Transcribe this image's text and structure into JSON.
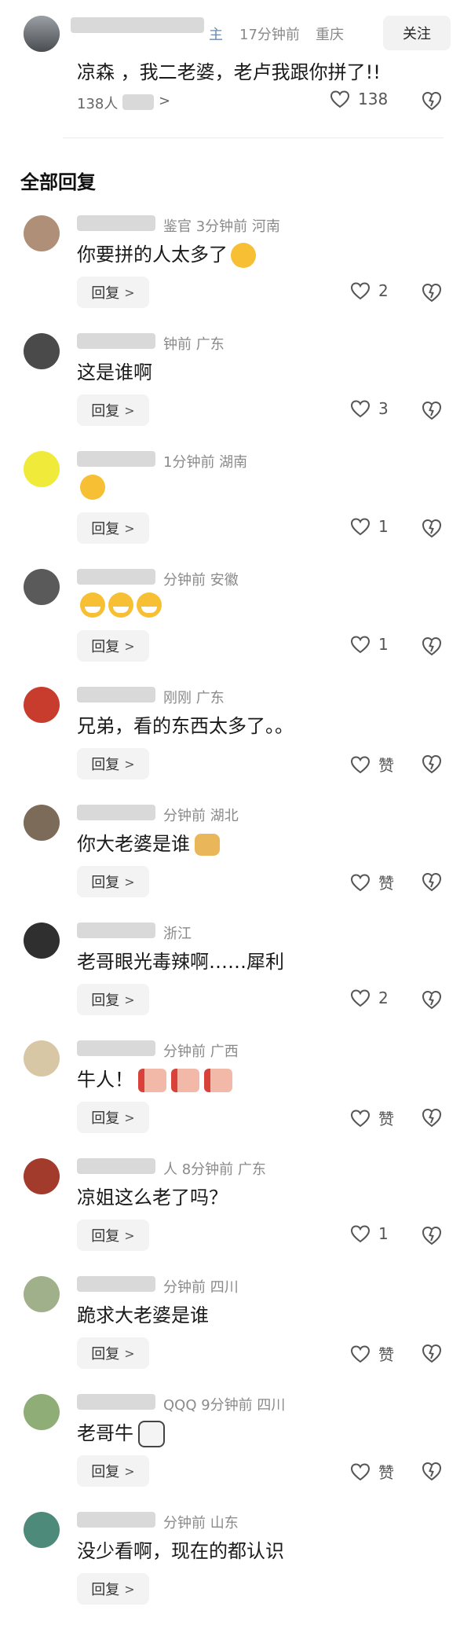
{
  "top_comment": {
    "badge": "主",
    "time": "17分钟前",
    "location": "重庆",
    "follow_label": "关注",
    "text": "凉森  ，我二老婆，老卢我跟你拼了!!",
    "views_label": "138人",
    "views_chevron": ">",
    "likes": "138",
    "avatar_color": "#6e6e6e"
  },
  "section_title": "全部回复",
  "reply_label": "回复",
  "comments": [
    {
      "meta": "鉴官  3分钟前  河南",
      "text": "你要拼的人太多了",
      "emoji": "laugh",
      "likes": "2"
    },
    {
      "meta": "钟前  广东",
      "text": "这是谁啊",
      "emoji": "",
      "likes": "3"
    },
    {
      "meta": "1分钟前  湖南",
      "text": "",
      "emoji": "laugh",
      "likes": "1"
    },
    {
      "meta": "分钟前  安徽",
      "text": "",
      "emoji": "cry3",
      "likes": "1"
    },
    {
      "meta": "刚刚  广东",
      "text": "兄弟，看的东西太多了。。",
      "emoji": "",
      "likes": "赞"
    },
    {
      "meta": "分钟前  湖北",
      "text": "你大老婆是谁",
      "emoji": "doge",
      "likes": "赞"
    },
    {
      "meta": "浙江",
      "text": "老哥眼光毒辣啊……犀利",
      "emoji": "",
      "likes": "2"
    },
    {
      "meta": "分钟前  广西",
      "text": "牛人！",
      "emoji": "thumbs",
      "likes": "赞"
    },
    {
      "meta": "人  8分钟前  广东",
      "text": "凉姐这么老了吗？",
      "emoji": "",
      "likes": "1"
    },
    {
      "meta": "分钟前  四川",
      "text": "跪求大老婆是谁",
      "emoji": "",
      "likes": "赞"
    },
    {
      "meta": "QQQ  9分钟前  四川",
      "text": "老哥牛",
      "emoji": "cow",
      "likes": "赞"
    },
    {
      "meta": "分钟前  山东",
      "text": "没少看啊，现在的都认识",
      "emoji": "",
      "likes": ""
    }
  ],
  "colors": {
    "background": "#ffffff",
    "meta": "#8a8a8a",
    "text": "#1a1a1a",
    "button_bg": "#f3f3f3"
  }
}
